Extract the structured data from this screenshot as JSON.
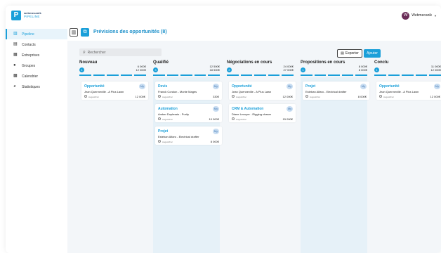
{
  "app": {
    "logo_letter": "P",
    "brand_line1": "webmecanik",
    "brand_line2": "PIPELINE"
  },
  "user": {
    "avatar_letter": "W",
    "name": "Webmecanik"
  },
  "sidebar": {
    "items": [
      {
        "label": "Pipeline",
        "icon": "columns-icon",
        "active": true
      },
      {
        "label": "Contacts",
        "icon": "contact-card-icon",
        "active": false
      },
      {
        "label": "Entreprises",
        "icon": "building-icon",
        "active": false
      },
      {
        "label": "Groupes",
        "icon": "group-icon",
        "active": false
      },
      {
        "label": "Calendrier",
        "icon": "calendar-icon",
        "active": false
      },
      {
        "label": "Statistiques",
        "icon": "chart-pie-icon",
        "active": false
      }
    ]
  },
  "header": {
    "title": "Prévisions des opportunités (8)"
  },
  "toolbar": {
    "search_placeholder": "Rechercher",
    "export_label": "Exporter",
    "add_label": "Ajouter"
  },
  "columns": [
    {
      "title": "Nouveau",
      "count": "1",
      "amount1": "6 000€",
      "amount2": "12 000€",
      "progress": 1,
      "tinted": false,
      "cards": [
        {
          "type": "Opportunité",
          "badge": "My",
          "name": "Jean Quenneville - A Plus Lawn",
          "date": "August/Fsc",
          "value": "12 000€"
        }
      ]
    },
    {
      "title": "Qualifié",
      "count": "3",
      "amount1": "12 500€",
      "amount2": "18 500€",
      "progress": 1,
      "tinted": true,
      "cards": [
        {
          "type": "Devis",
          "badge": "My",
          "name": "Franck Condon - Monte Mages",
          "date": "August/Fsc",
          "value": "330€"
        },
        {
          "type": "Automation",
          "badge": "My",
          "name": "Amber Duplessis - Purity",
          "date": "August/Fsc",
          "value": "10 000€"
        },
        {
          "type": "Projet",
          "badge": "My",
          "name": "Esteban Alfaro - Electrical drafter",
          "date": "August/Fsc",
          "value": "8 000€"
        }
      ]
    },
    {
      "title": "Négociations en cours",
      "count": "2",
      "amount1": "24 000€",
      "amount2": "27 000€",
      "progress": 1,
      "tinted": false,
      "cards": [
        {
          "type": "Opportunité",
          "badge": "My",
          "name": "Jean Quenneville - A Plus Lawn",
          "date": "August/Fsc",
          "value": "12 000€"
        },
        {
          "type": "CRM & Automation",
          "badge": "My",
          "name": "Diane Lecuyer - Rigging chaser",
          "date": "August/Fsc",
          "value": "15 000€"
        }
      ]
    },
    {
      "title": "Propositions en cours",
      "count": "1",
      "amount1": "8 000€",
      "amount2": "8 000€",
      "progress": 1,
      "tinted": true,
      "cards": [
        {
          "type": "Projet",
          "badge": "My",
          "name": "Esteban Alfaro - Electrical drafter",
          "date": "August/Fsc",
          "value": "8 000€"
        }
      ]
    },
    {
      "title": "Conclu",
      "count": "1",
      "amount1": "11 000€",
      "amount2": "12 000€",
      "progress": 1,
      "tinted": false,
      "cards": [
        {
          "type": "Opportunité",
          "badge": "My",
          "name": "Jean Quenneville - A Plus Lawn",
          "date": "August/Fsc",
          "value": "12 000€"
        }
      ]
    }
  ],
  "colors": {
    "accent": "#1a9fd9",
    "column_tint": "#e6f1f8",
    "avatar": "#6a2c57"
  }
}
